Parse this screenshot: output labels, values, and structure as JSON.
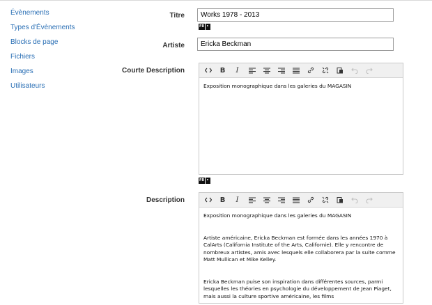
{
  "sidebar": {
    "items": [
      {
        "label": "Évènements"
      },
      {
        "label": "Types d'Évènements"
      },
      {
        "label": "Blocks de page"
      },
      {
        "label": "Fichiers"
      },
      {
        "label": "Images"
      },
      {
        "label": "Utilisateurs"
      }
    ]
  },
  "form": {
    "titre": {
      "label": "Titre",
      "value": "Works 1978 - 2013",
      "lang": "FR"
    },
    "artiste": {
      "label": "Artiste",
      "value": "Ericka Beckman"
    },
    "courte_description": {
      "label": "Courte Description",
      "lang": "FR",
      "text": "Exposition monographique dans les galeries du MAGASIN"
    },
    "description": {
      "label": "Description",
      "paragraphs": [
        "Exposition monographique dans les galeries du MAGASIN",
        "Artiste américaine, Ericka Beckman est formée dans les années 1970 à CalArts (California Institute of the Arts, Californie). Elle y rencontre de nombreux artistes, amis avec lesquels elle collaborera par la suite comme Matt Mullican et Mike Kelley.",
        "Ericka Beckman puise son inspiration dans différentes sources, parmi lesquelles les théories en psychologie du développement de Jean Piaget, mais aussi la culture sportive américaine, les films"
      ]
    }
  },
  "toolbar_icons": [
    "code-icon",
    "bold-icon",
    "italic-icon",
    "align-left-icon",
    "align-center-icon",
    "align-right-icon",
    "align-justify-icon",
    "link-icon",
    "unlink-icon",
    "paste-icon",
    "undo-icon",
    "redo-icon"
  ],
  "colors": {
    "link": "#2a6fb5",
    "toolbar_bg": "#f0f0f0"
  }
}
